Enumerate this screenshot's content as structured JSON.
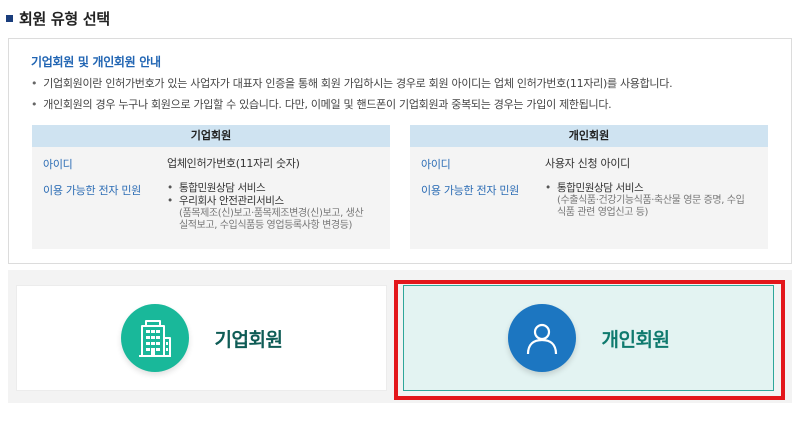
{
  "section": {
    "title": "회원 유형 선택"
  },
  "guide": {
    "title": "기업회원 및 개인회원 안내",
    "lines": [
      "기업회원이란 인허가번호가 있는 사업자가 대표자 인증을 통해 회원 가입하시는 경우로 회원 아이디는 업체 인허가번호(11자리)를 사용합니다.",
      "개인회원의 경우 누구나 회원으로 가입할 수 있습니다. 다만, 이메일 및 핸드폰이 기업회원과 중복되는 경우는 가입이 제한됩니다."
    ],
    "bullet": "•"
  },
  "corporate_panel": {
    "header": "기업회원",
    "id_label": "아이디",
    "id_value": "업체인허가번호(11자리 숫자)",
    "services_label": "이용 가능한 전자 민원",
    "services": [
      {
        "name": "통합민원상담 서비스",
        "sub": []
      },
      {
        "name": "우리회사 안전관리서비스",
        "sub": [
          "(품목제조(신)보고·품목제조변경(신)보고, 생산",
          "실적보고, 수입식품등 영업등록사항 변경등)"
        ]
      }
    ]
  },
  "individual_panel": {
    "header": "개인회원",
    "id_label": "아이디",
    "id_value": "사용자 신청 아이디",
    "services_label": "이용 가능한 전자 민원",
    "services": [
      {
        "name": "통합민원상담 서비스",
        "sub": [
          "(수출식품·건강기능식품·축산물 영문 증명, 수입",
          "식품 관련 영업신고 등)"
        ]
      }
    ]
  },
  "cards": {
    "corporate_label": "기업회원",
    "corporate_icon": "building-icon",
    "individual_label": "개인회원",
    "individual_icon": "person-icon",
    "selected": "individual"
  },
  "colors": {
    "accent_blue": "#2165b3",
    "teal": "#19b89a",
    "person_blue": "#1c76c1",
    "selection_red": "#e3161b",
    "panel_header": "#cfe3f1"
  }
}
